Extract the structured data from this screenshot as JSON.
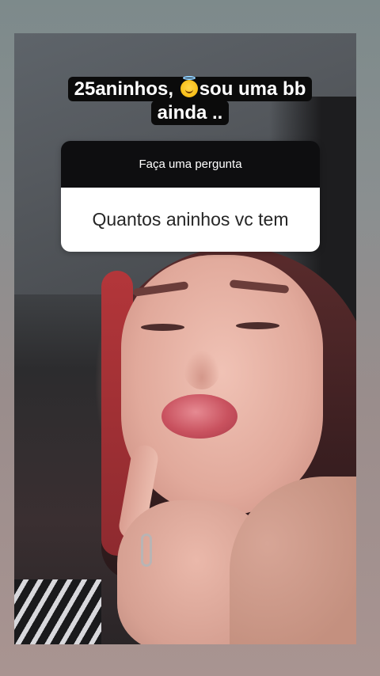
{
  "story": {
    "caption": {
      "line1_before_emoji": "25aninhos, ",
      "emoji": "smiling-face-with-halo",
      "line1_after_emoji": "sou uma bb",
      "line2": "ainda .."
    },
    "question_sticker": {
      "header": "Faça uma pergunta",
      "answer": "Quantos aninhos vc tem"
    }
  },
  "colors": {
    "sticker_header_bg": "#0e0e10",
    "sticker_body_bg": "#ffffff",
    "caption_bg": "#0b0b0b",
    "caption_text": "#ffffff"
  }
}
